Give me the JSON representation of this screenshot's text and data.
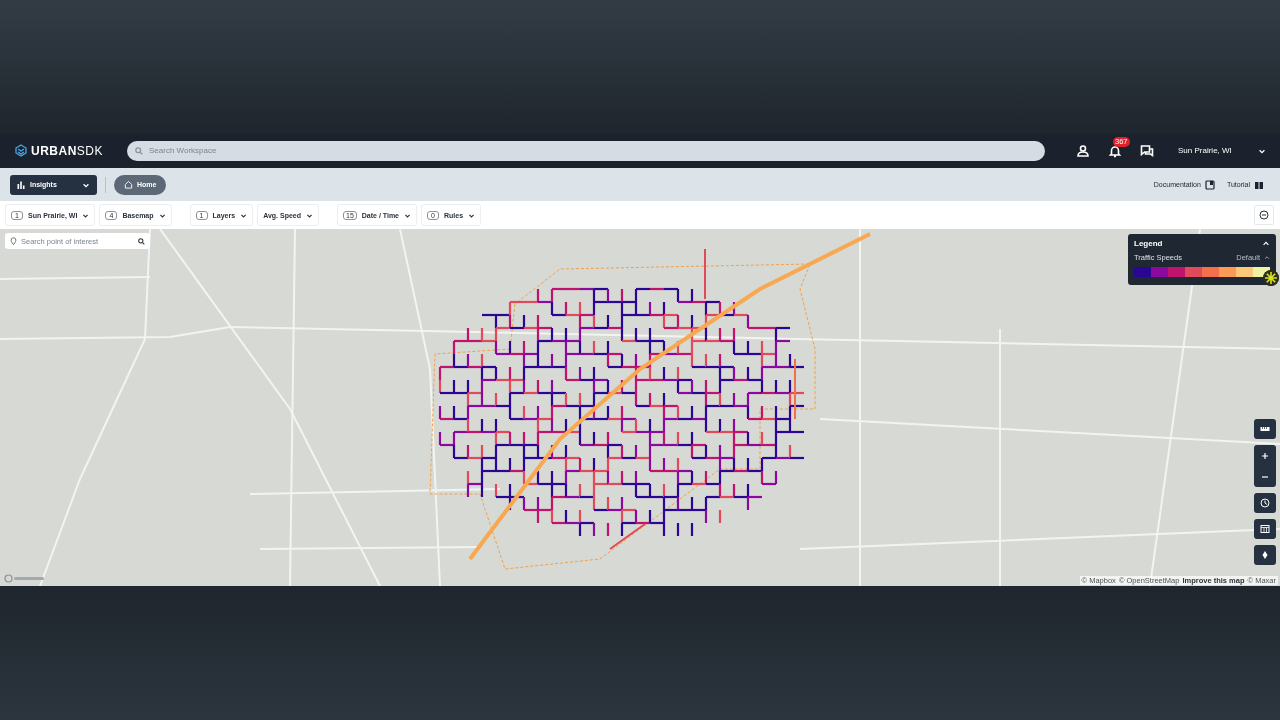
{
  "header": {
    "logo": "**URBAN**SDK",
    "search_placeholder": "Search Workspace",
    "notification_count": "367",
    "location": "Sun Prairie, WI"
  },
  "toolbar": {
    "module": "Insights",
    "home": "Home",
    "links": [
      "Documentation",
      "Tutorial"
    ]
  },
  "filters": [
    {
      "count": "1",
      "label": "Sun Prairie, WI"
    },
    {
      "count": "4",
      "label": "Basemap"
    },
    {
      "count": "1",
      "label": "Layers"
    },
    {
      "label": "Avg. Speed"
    },
    {
      "count": "15",
      "label": "Date / Time"
    },
    {
      "count": "0",
      "label": "Rules"
    }
  ],
  "map": {
    "poi_search_placeholder": "Search point of interest",
    "legend": {
      "title": "Legend",
      "layer": "Traffic Speeds",
      "style": "Default",
      "swatches": [
        {
          "color": "#2c0594"
        },
        {
          "color": "#8a0aa0"
        },
        {
          "color": "#c0136e"
        },
        {
          "color": "#e04a5a"
        },
        {
          "color": "#f4704a"
        },
        {
          "color": "#fc9a55"
        },
        {
          "color": "#fdc778"
        },
        {
          "color": "#eef3a4"
        }
      ]
    },
    "attribution": [
      {
        "text": "© Mapbox",
        "kind": "text"
      },
      {
        "text": "© OpenStreetMap",
        "kind": "text"
      },
      {
        "text": "Improve this map",
        "kind": "link"
      },
      {
        "text": "© Maxar",
        "kind": "text"
      }
    ]
  }
}
